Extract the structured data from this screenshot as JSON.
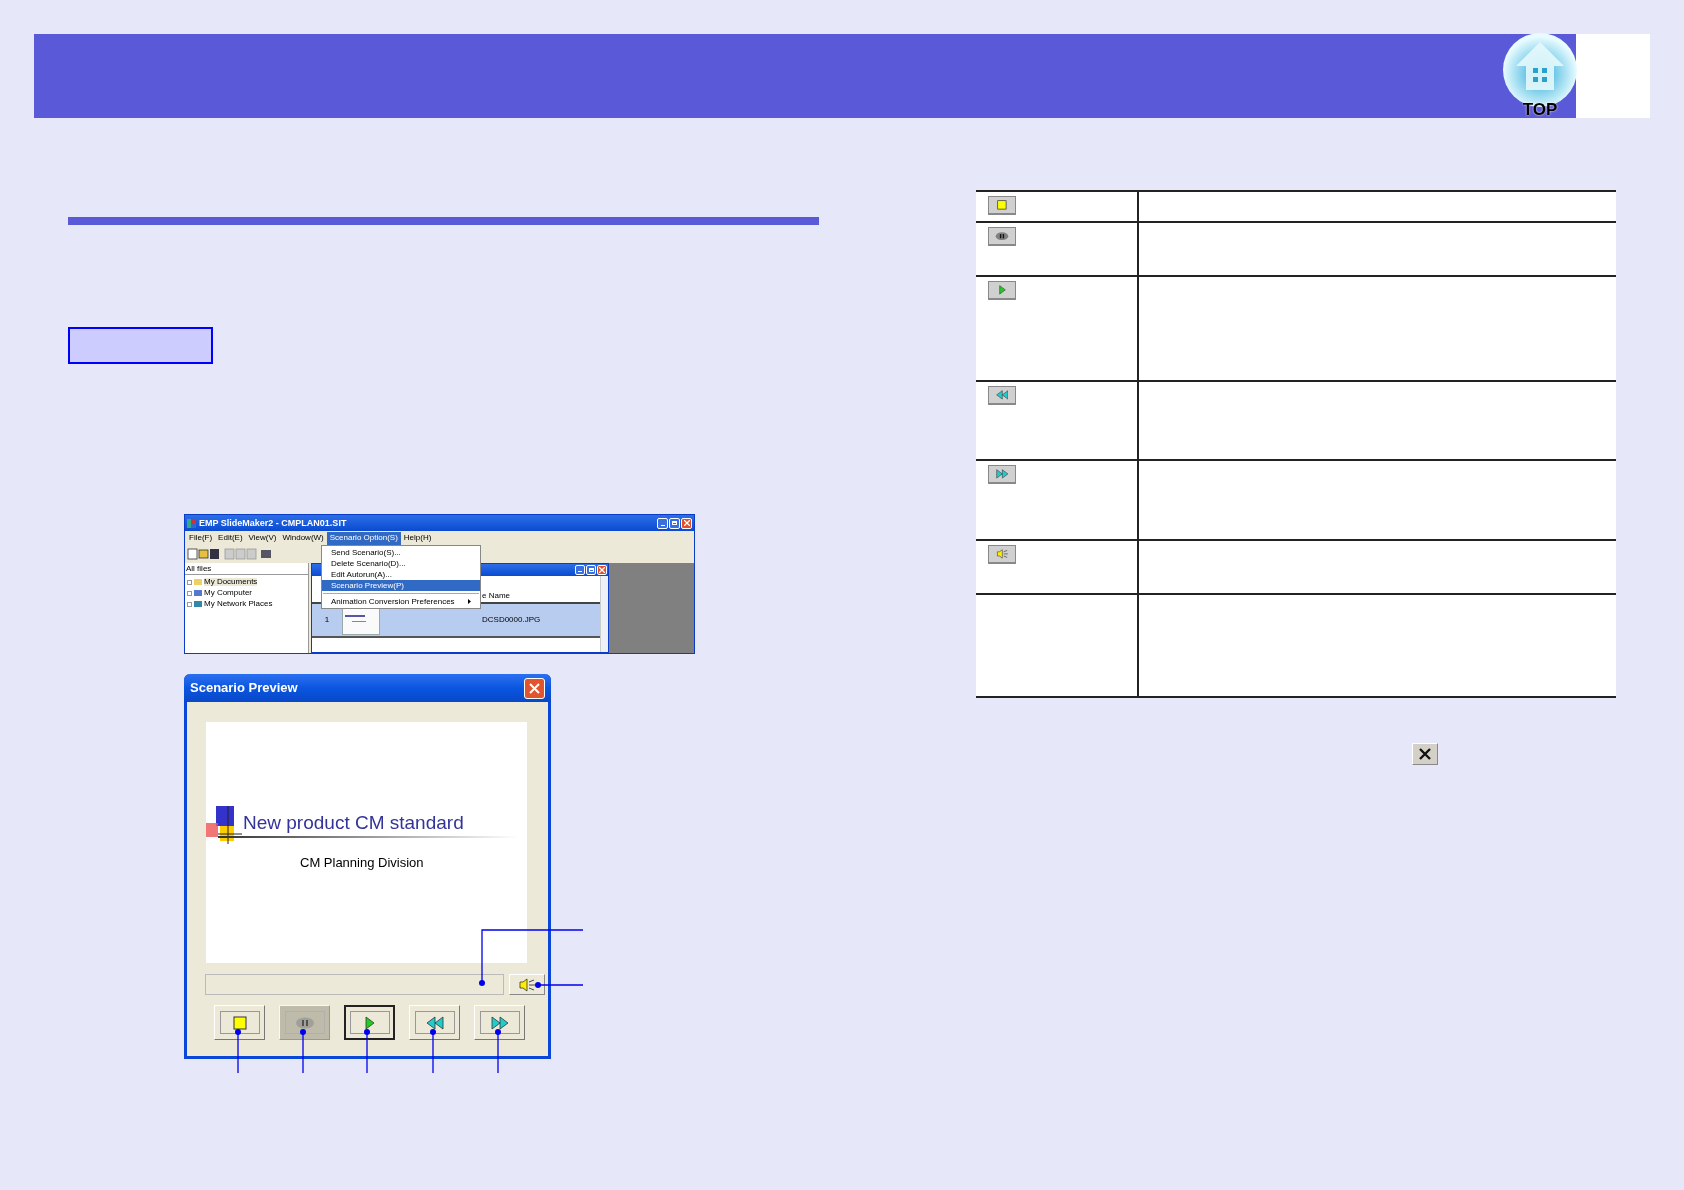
{
  "header": {
    "top_button": "TOP"
  },
  "app_window": {
    "title": "EMP SlideMaker2 - CMPLAN01.SIT",
    "menu": [
      {
        "label": "File(F)",
        "selected": false
      },
      {
        "label": "Edit(E)",
        "selected": false
      },
      {
        "label": "View(V)",
        "selected": false
      },
      {
        "label": "Window(W)",
        "selected": false
      },
      {
        "label": "Scenario Option(S)",
        "selected": true
      },
      {
        "label": "Help(H)",
        "selected": false
      }
    ],
    "dropdown": [
      {
        "label": "Send Scenario(S)...",
        "selected": false,
        "submenu": false
      },
      {
        "label": "Delete Scenario(D)...",
        "selected": false,
        "submenu": false
      },
      {
        "label": "Edit Autorun(A)...",
        "selected": false,
        "submenu": false
      },
      {
        "label": "Scenario Preview(P)",
        "selected": true,
        "submenu": false
      },
      {
        "label": "Animation Conversion Preferences",
        "selected": false,
        "submenu": true
      }
    ],
    "tree_header": "All files",
    "tree": [
      {
        "label": "My Documents",
        "selected": true
      },
      {
        "label": "My Computer",
        "selected": false
      },
      {
        "label": "My Network Places",
        "selected": false
      }
    ],
    "list_column": "e Name",
    "rows": [
      {
        "number": "1",
        "file": "DCSD0000.JPG"
      }
    ]
  },
  "preview_window": {
    "title": "Scenario Preview",
    "slide_title": "New product CM standard",
    "slide_subtitle": "CM Planning Division",
    "controls": [
      {
        "kind": "stop",
        "disabled": false,
        "selected": false
      },
      {
        "kind": "pause",
        "disabled": true,
        "selected": false
      },
      {
        "kind": "play",
        "disabled": false,
        "selected": true
      },
      {
        "kind": "rewind",
        "disabled": false,
        "selected": false
      },
      {
        "kind": "forward",
        "disabled": false,
        "selected": false
      }
    ],
    "sound": {
      "kind": "sound"
    }
  },
  "table": {
    "rows": [
      {
        "kind": "stop"
      },
      {
        "kind": "pause"
      },
      {
        "kind": "play"
      },
      {
        "kind": "rewind"
      },
      {
        "kind": "forward"
      },
      {
        "kind": "sound"
      },
      {
        "kind": "blank"
      }
    ]
  }
}
